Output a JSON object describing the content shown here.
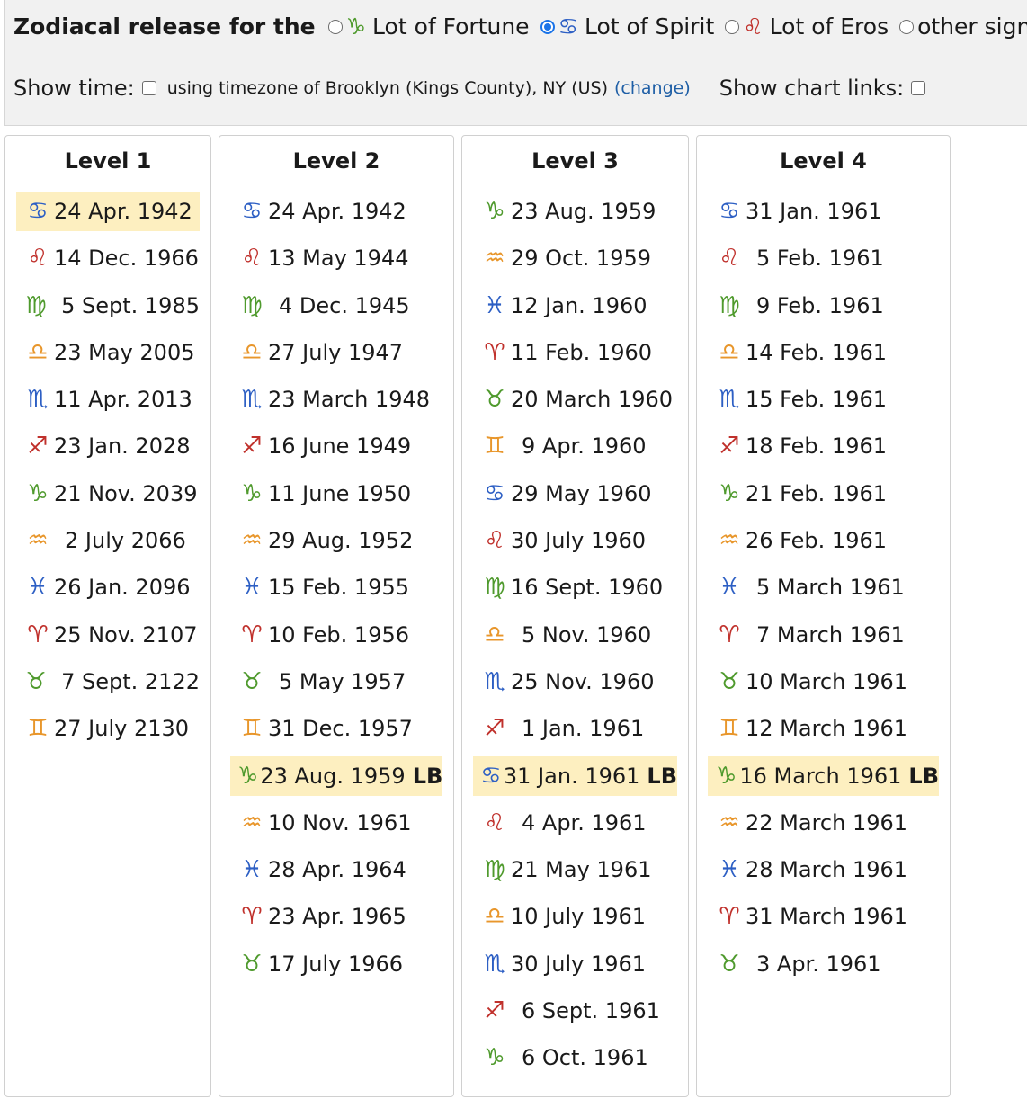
{
  "header": {
    "title": "Zodiacal release for the",
    "options": [
      {
        "symbol": "♑",
        "color": "#4f9a2d",
        "label": "Lot of Fortune",
        "checked": false
      },
      {
        "symbol": "♋",
        "color": "#2d5fc4",
        "label": "Lot of Spirit",
        "checked": true
      },
      {
        "symbol": "♌",
        "color": "#c0312c",
        "label": "Lot of Eros",
        "checked": false
      },
      {
        "symbol": "",
        "color": "",
        "label": "other sign",
        "checked": false
      }
    ],
    "show_time_label": "Show time:",
    "timezone_text": "using timezone of Brooklyn (Kings County), NY (US)",
    "change_link": "(change)",
    "show_chart_links_label": "Show chart links:"
  },
  "columns": [
    {
      "title": "Level 1",
      "rows": [
        {
          "symbol": "♋",
          "color": "blue",
          "date": "24 Apr. 1942",
          "highlight": true,
          "lb": ""
        },
        {
          "symbol": "♌",
          "color": "red",
          "date": "14 Dec. 1966"
        },
        {
          "symbol": "♍",
          "color": "green",
          "date": "5 Sept. 1985",
          "pad": true
        },
        {
          "symbol": "♎",
          "color": "orange",
          "date": "23 May 2005"
        },
        {
          "symbol": "♏",
          "color": "blue",
          "date": "11 Apr. 2013"
        },
        {
          "symbol": "♐",
          "color": "red",
          "date": "23 Jan. 2028"
        },
        {
          "symbol": "♑",
          "color": "green",
          "date": "21 Nov. 2039"
        },
        {
          "symbol": "♒",
          "color": "orange",
          "date": "2 July 2066",
          "pad": true
        },
        {
          "symbol": "♓",
          "color": "blue",
          "date": "26 Jan. 2096"
        },
        {
          "symbol": "♈",
          "color": "red",
          "date": "25 Nov. 2107"
        },
        {
          "symbol": "♉",
          "color": "green",
          "date": "7 Sept. 2122",
          "pad": true
        },
        {
          "symbol": "♊",
          "color": "orange",
          "date": "27 July 2130"
        }
      ]
    },
    {
      "title": "Level 2",
      "rows": [
        {
          "symbol": "♋",
          "color": "blue",
          "date": "24 Apr. 1942"
        },
        {
          "symbol": "♌",
          "color": "red",
          "date": "13 May 1944"
        },
        {
          "symbol": "♍",
          "color": "green",
          "date": "4 Dec. 1945",
          "pad": true
        },
        {
          "symbol": "♎",
          "color": "orange",
          "date": "27 July 1947"
        },
        {
          "symbol": "♏",
          "color": "blue",
          "date": "23 March 1948"
        },
        {
          "symbol": "♐",
          "color": "red",
          "date": "16 June 1949"
        },
        {
          "symbol": "♑",
          "color": "green",
          "date": "11 June 1950"
        },
        {
          "symbol": "♒",
          "color": "orange",
          "date": "29 Aug. 1952"
        },
        {
          "symbol": "♓",
          "color": "blue",
          "date": "15 Feb. 1955"
        },
        {
          "symbol": "♈",
          "color": "red",
          "date": "10 Feb. 1956"
        },
        {
          "symbol": "♉",
          "color": "green",
          "date": "5 May 1957",
          "pad": true
        },
        {
          "symbol": "♊",
          "color": "orange",
          "date": "31 Dec. 1957"
        },
        {
          "symbol": "♑",
          "color": "green",
          "date": "23 Aug. 1959",
          "highlight": true,
          "lb": "LB"
        },
        {
          "symbol": "♒",
          "color": "orange",
          "date": "10 Nov. 1961"
        },
        {
          "symbol": "♓",
          "color": "blue",
          "date": "28 Apr. 1964"
        },
        {
          "symbol": "♈",
          "color": "red",
          "date": "23 Apr. 1965"
        },
        {
          "symbol": "♉",
          "color": "green",
          "date": "17 July 1966"
        }
      ]
    },
    {
      "title": "Level 3",
      "rows": [
        {
          "symbol": "♑",
          "color": "green",
          "date": "23 Aug. 1959"
        },
        {
          "symbol": "♒",
          "color": "orange",
          "date": "29 Oct. 1959"
        },
        {
          "symbol": "♓",
          "color": "blue",
          "date": "12 Jan. 1960"
        },
        {
          "symbol": "♈",
          "color": "red",
          "date": "11 Feb. 1960"
        },
        {
          "symbol": "♉",
          "color": "green",
          "date": "20 March 1960"
        },
        {
          "symbol": "♊",
          "color": "orange",
          "date": "9 Apr. 1960",
          "pad": true
        },
        {
          "symbol": "♋",
          "color": "blue",
          "date": "29 May 1960"
        },
        {
          "symbol": "♌",
          "color": "red",
          "date": "30 July 1960"
        },
        {
          "symbol": "♍",
          "color": "green",
          "date": "16 Sept. 1960"
        },
        {
          "symbol": "♎",
          "color": "orange",
          "date": "5 Nov. 1960",
          "pad": true
        },
        {
          "symbol": "♏",
          "color": "blue",
          "date": "25 Nov. 1960"
        },
        {
          "symbol": "♐",
          "color": "red",
          "date": "1 Jan. 1961",
          "pad": true
        },
        {
          "symbol": "♋",
          "color": "blue",
          "date": "31 Jan. 1961",
          "highlight": true,
          "lb": "LB"
        },
        {
          "symbol": "♌",
          "color": "red",
          "date": "4 Apr. 1961",
          "pad": true
        },
        {
          "symbol": "♍",
          "color": "green",
          "date": "21 May 1961"
        },
        {
          "symbol": "♎",
          "color": "orange",
          "date": "10 July 1961"
        },
        {
          "symbol": "♏",
          "color": "blue",
          "date": "30 July 1961"
        },
        {
          "symbol": "♐",
          "color": "red",
          "date": "6 Sept. 1961",
          "pad": true
        },
        {
          "symbol": "♑",
          "color": "green",
          "date": "6 Oct. 1961",
          "pad": true
        }
      ]
    },
    {
      "title": "Level 4",
      "rows": [
        {
          "symbol": "♋",
          "color": "blue",
          "date": "31 Jan. 1961"
        },
        {
          "symbol": "♌",
          "color": "red",
          "date": "5 Feb. 1961",
          "pad": true
        },
        {
          "symbol": "♍",
          "color": "green",
          "date": "9 Feb. 1961",
          "pad": true
        },
        {
          "symbol": "♎",
          "color": "orange",
          "date": "14 Feb. 1961"
        },
        {
          "symbol": "♏",
          "color": "blue",
          "date": "15 Feb. 1961"
        },
        {
          "symbol": "♐",
          "color": "red",
          "date": "18 Feb. 1961"
        },
        {
          "symbol": "♑",
          "color": "green",
          "date": "21 Feb. 1961"
        },
        {
          "symbol": "♒",
          "color": "orange",
          "date": "26 Feb. 1961"
        },
        {
          "symbol": "♓",
          "color": "blue",
          "date": "5 March 1961",
          "pad": true
        },
        {
          "symbol": "♈",
          "color": "red",
          "date": "7 March 1961",
          "pad": true
        },
        {
          "symbol": "♉",
          "color": "green",
          "date": "10 March 1961"
        },
        {
          "symbol": "♊",
          "color": "orange",
          "date": "12 March 1961"
        },
        {
          "symbol": "♑",
          "color": "green",
          "date": "16 March 1961",
          "highlight": true,
          "lb": "LB"
        },
        {
          "symbol": "♒",
          "color": "orange",
          "date": "22 March 1961"
        },
        {
          "symbol": "♓",
          "color": "blue",
          "date": "28 March 1961"
        },
        {
          "symbol": "♈",
          "color": "red",
          "date": "31 March 1961"
        },
        {
          "symbol": "♉",
          "color": "green",
          "date": "3 Apr. 1961",
          "pad": true
        }
      ]
    }
  ]
}
